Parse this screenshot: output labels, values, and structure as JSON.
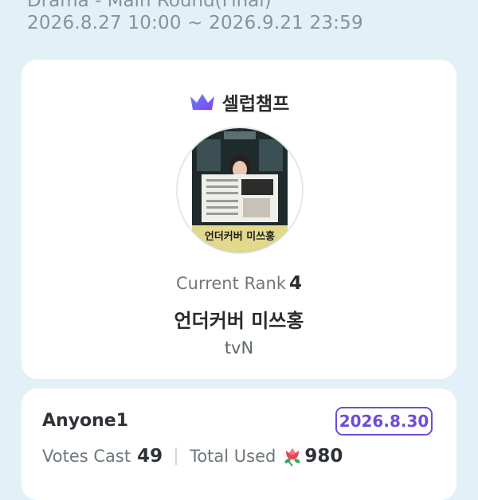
{
  "header": {
    "title": "Drama - Main Round(Final)",
    "period": "2026.8.27 10:00 ~ 2026.9.21 23:59"
  },
  "main_card": {
    "brand_icon": "crown-icon",
    "brand_name": "셀럽챔프",
    "poster_title": "언더커버 미쓰홍",
    "rank_label": "Current Rank",
    "rank_value": "4",
    "show_title": "언더커버 미쓰홍",
    "channel": "tvN"
  },
  "vote_card": {
    "voter": "Anyone1",
    "date": "2026.8.30",
    "votes_label": "Votes Cast",
    "votes_value": "49",
    "total_label": "Total Used",
    "total_icon": "flower-icon",
    "total_value": "980"
  },
  "colors": {
    "background": "#e2f1f7",
    "accent": "#6f4bd8",
    "crown": "#7b4ff0",
    "flower": "#e8455a"
  }
}
